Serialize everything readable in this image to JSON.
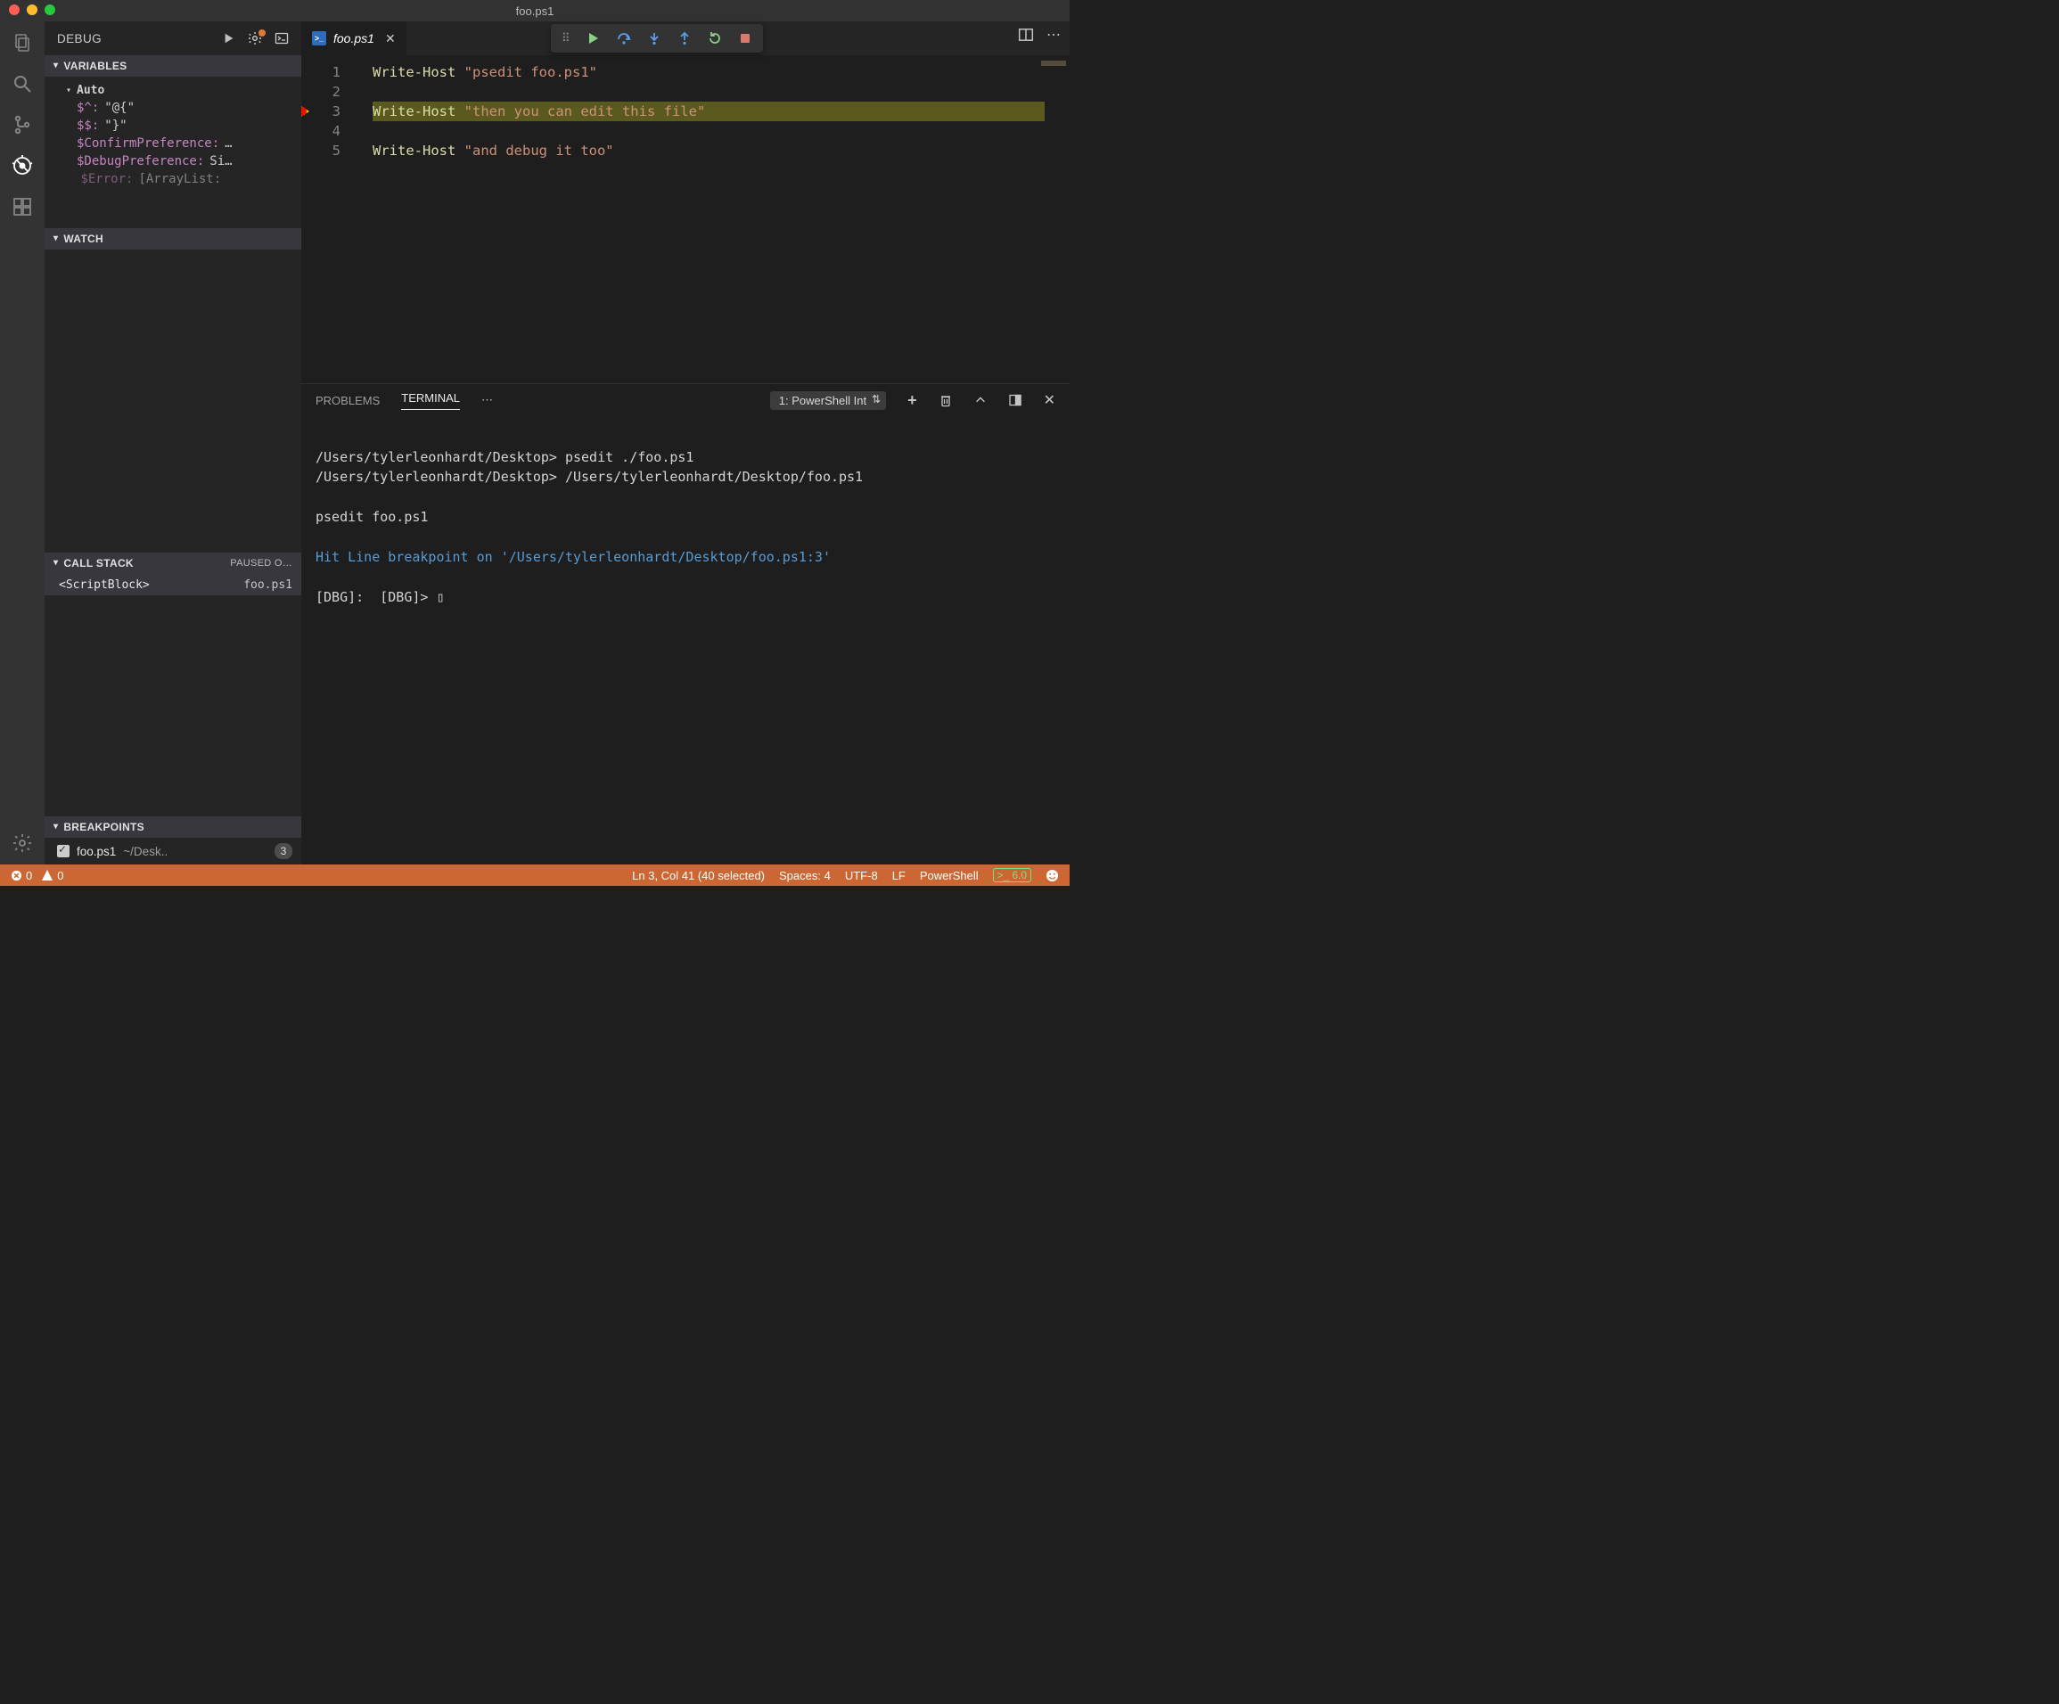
{
  "window": {
    "title": "foo.ps1"
  },
  "activitybar": {
    "items": [
      {
        "name": "explorer-icon"
      },
      {
        "name": "search-icon"
      },
      {
        "name": "scm-icon"
      },
      {
        "name": "debug-icon",
        "active": true
      },
      {
        "name": "extensions-icon"
      }
    ],
    "bottom": [
      {
        "name": "settings-icon"
      }
    ]
  },
  "sidebar": {
    "title": "DEBUG",
    "start_tooltip": "Start Debugging",
    "config_badge": true,
    "sections": {
      "variables": {
        "label": "VARIABLES",
        "auto_label": "Auto",
        "rows": [
          {
            "k": "$^:",
            "v": "\"@{\""
          },
          {
            "k": "$$:",
            "v": "\"}\""
          },
          {
            "k": "$ConfirmPreference:",
            "v": "…"
          },
          {
            "k": "$DebugPreference:",
            "v": "Si…"
          },
          {
            "k": "$Error:",
            "v": "[ArrayList:"
          }
        ]
      },
      "watch": {
        "label": "WATCH"
      },
      "callstack": {
        "label": "CALL STACK",
        "status": "PAUSED O…",
        "rows": [
          {
            "left": "<ScriptBlock>",
            "right": "foo.ps1"
          }
        ]
      },
      "breakpoints": {
        "label": "BREAKPOINTS",
        "rows": [
          {
            "checked": true,
            "file": "foo.ps1",
            "path": "~/Desk..",
            "line": "3"
          }
        ]
      }
    }
  },
  "editor": {
    "tab": {
      "filename": "foo.ps1"
    },
    "debug_toolbar": {
      "items": [
        "continue",
        "step-over",
        "step-into",
        "step-out",
        "restart",
        "stop"
      ]
    },
    "lines": [
      {
        "n": "1",
        "cmd": "Write-Host",
        "str": "\"psedit foo.ps1\""
      },
      {
        "n": "2",
        "cmd": "",
        "str": ""
      },
      {
        "n": "3",
        "cmd": "Write-Host",
        "str": "\"then you can edit this file\"",
        "current": true,
        "breakpoint": true
      },
      {
        "n": "4",
        "cmd": "",
        "str": ""
      },
      {
        "n": "5",
        "cmd": "Write-Host",
        "str": "\"and debug it too\""
      }
    ]
  },
  "panel": {
    "tabs": {
      "problems": "PROBLEMS",
      "terminal": "TERMINAL",
      "active": "terminal"
    },
    "terminal_selector": "1: PowerShell Int",
    "terminal_lines": [
      {
        "t": "/Users/tylerleonhardt/Desktop> psedit ./foo.ps1"
      },
      {
        "t": "/Users/tylerleonhardt/Desktop> /Users/tylerleonhardt/Desktop/foo.ps1"
      },
      {
        "t": ""
      },
      {
        "t": "psedit foo.ps1"
      },
      {
        "t": ""
      },
      {
        "t": "Hit Line breakpoint on '/Users/tylerleonhardt/Desktop/foo.ps1:3'",
        "cls": "term-blue"
      },
      {
        "t": ""
      },
      {
        "t": "[DBG]:  [DBG]> ▯"
      }
    ]
  },
  "statusbar": {
    "errors": "0",
    "warnings": "0",
    "cursor": "Ln 3, Col 41 (40 selected)",
    "spaces": "Spaces: 4",
    "encoding": "UTF-8",
    "eol": "LF",
    "lang": "PowerShell",
    "term": "6.0",
    "feedback_icon": "smiley-icon"
  }
}
